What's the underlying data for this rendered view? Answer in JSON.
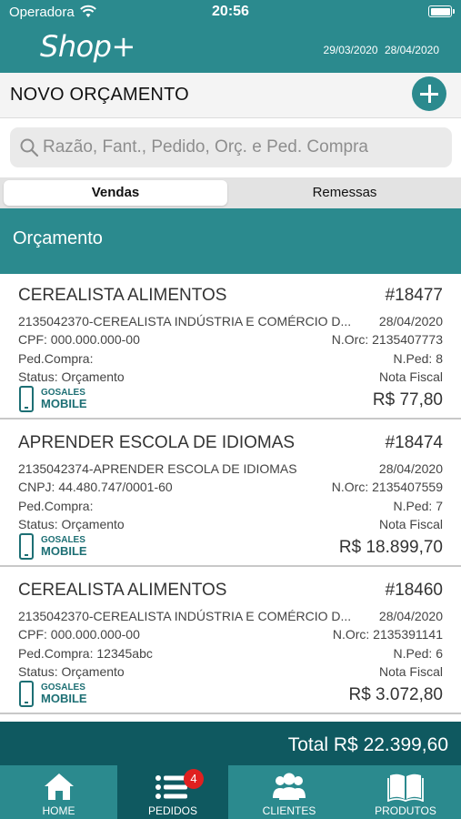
{
  "status_bar": {
    "carrier": "Operadora",
    "time": "20:56"
  },
  "header": {
    "logo": "Shop+",
    "date_from": "29/03/2020",
    "date_to": "28/04/2020"
  },
  "titlebar": {
    "title": "NOVO ORÇAMENTO"
  },
  "search": {
    "placeholder": "Razão, Fant., Pedido, Orç. e Ped. Compra"
  },
  "segments": {
    "active": "Vendas",
    "other": "Remessas"
  },
  "section": {
    "label": "Orçamento"
  },
  "orders": [
    {
      "name": "CEREALISTA ALIMENTOS",
      "number": "#18477",
      "company": "2135042370-CEREALISTA INDÚSTRIA E COMÉRCIO D...",
      "date": "28/04/2020",
      "doc": "CPF: 000.000.000-00",
      "norc": "N.Orc: 2135407773",
      "ped_compra": "Ped.Compra:",
      "nped": "N.Ped: 8",
      "status": "Status: Orçamento",
      "nota": "Nota Fiscal",
      "brand_top": "GOSALES",
      "brand_bottom": "MOBILE",
      "price": "R$ 77,80"
    },
    {
      "name": "APRENDER ESCOLA DE IDIOMAS",
      "number": "#18474",
      "company": "2135042374-APRENDER ESCOLA DE IDIOMAS",
      "date": "28/04/2020",
      "doc": "CNPJ: 44.480.747/0001-60",
      "norc": "N.Orc: 2135407559",
      "ped_compra": "Ped.Compra:",
      "nped": "N.Ped: 7",
      "status": "Status: Orçamento",
      "nota": "Nota Fiscal",
      "brand_top": "GOSALES",
      "brand_bottom": "MOBILE",
      "price": "R$ 18.899,70"
    },
    {
      "name": "CEREALISTA ALIMENTOS",
      "number": "#18460",
      "company": "2135042370-CEREALISTA INDÚSTRIA E COMÉRCIO D...",
      "date": "28/04/2020",
      "doc": "CPF: 000.000.000-00",
      "norc": "N.Orc: 2135391141",
      "ped_compra": "Ped.Compra: 12345abc",
      "nped": "N.Ped: 6",
      "status": "Status: Orçamento",
      "nota": "Nota Fiscal",
      "brand_top": "GOSALES",
      "brand_bottom": "MOBILE",
      "price": "R$ 3.072,80"
    }
  ],
  "total": {
    "label": "Total R$ 22.399,60"
  },
  "tabbar": {
    "items": [
      {
        "label": "HOME",
        "icon": "home-icon"
      },
      {
        "label": "PEDIDOS",
        "icon": "list-icon",
        "badge": "4"
      },
      {
        "label": "CLIENTES",
        "icon": "users-icon"
      },
      {
        "label": "PRODUTOS",
        "icon": "book-icon"
      }
    ]
  },
  "colors": {
    "primary": "#2b8a8e",
    "dark": "#0f5960",
    "badge": "#e02020"
  }
}
